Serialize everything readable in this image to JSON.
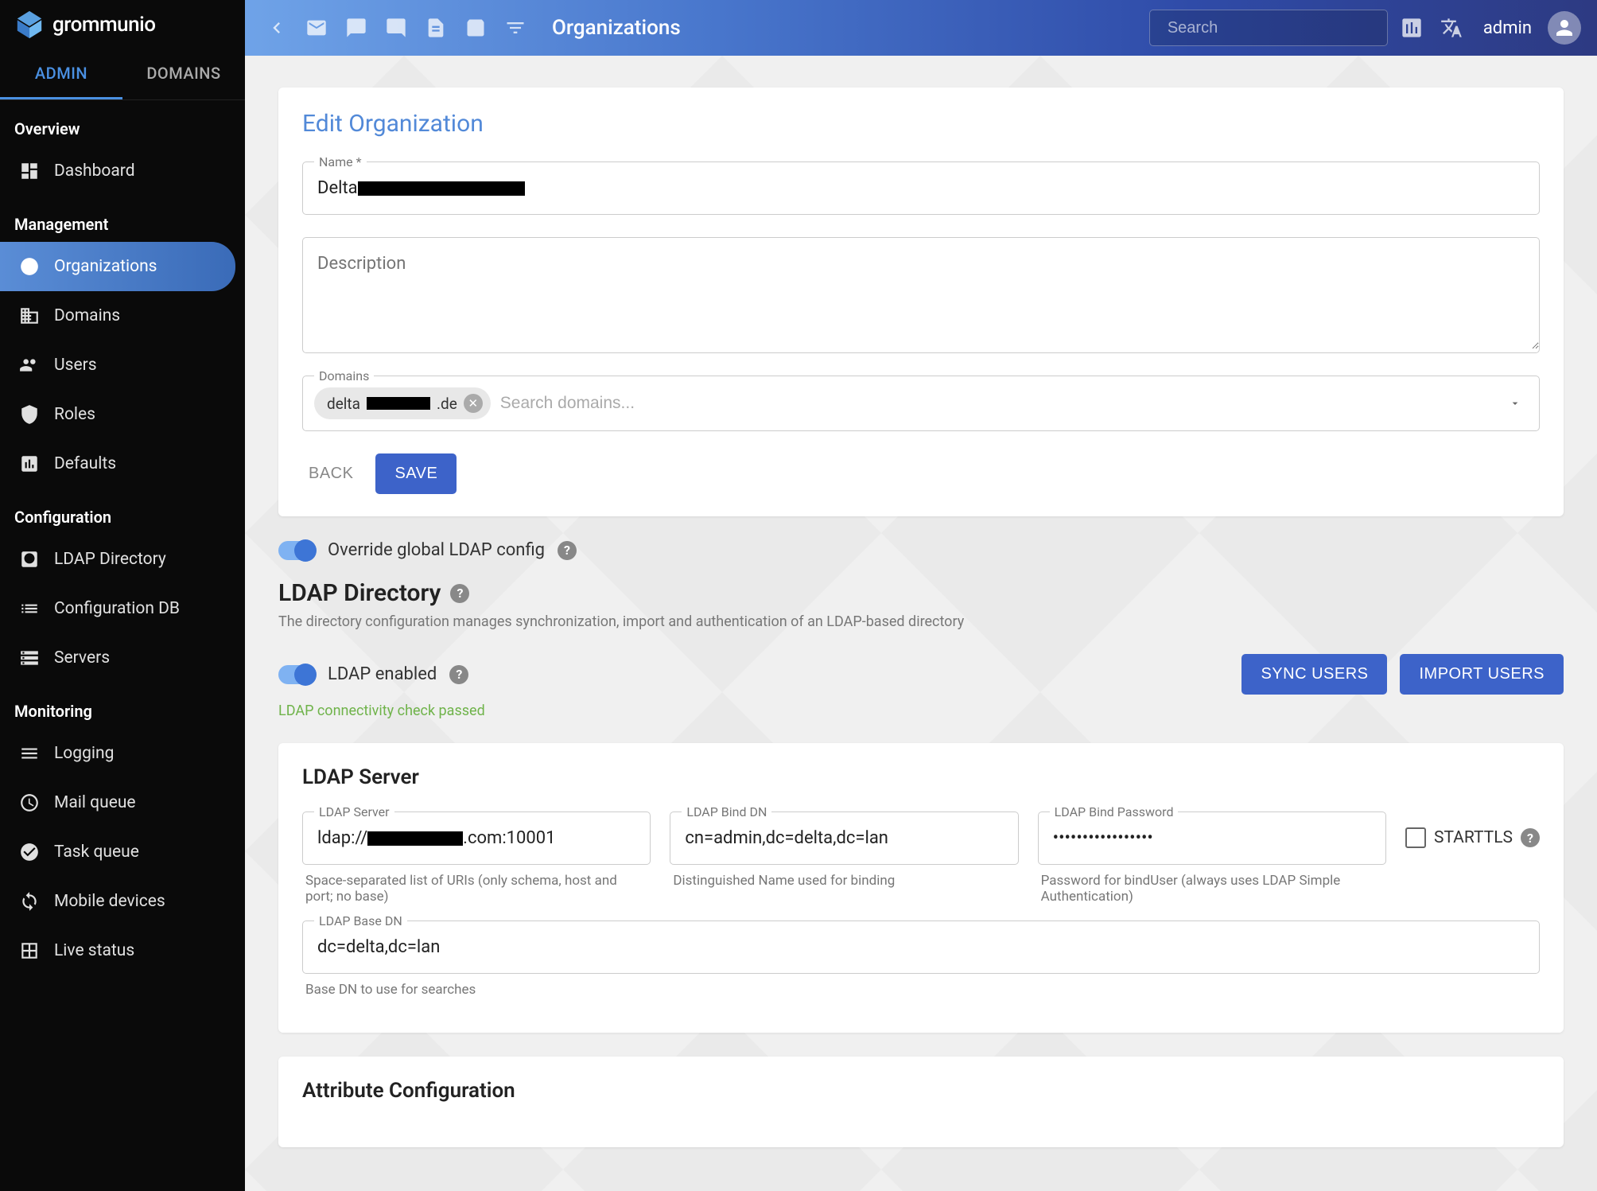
{
  "brand": "grommunio",
  "topbar": {
    "title": "Organizations",
    "search_placeholder": "Search",
    "user": "admin"
  },
  "sidebar": {
    "tabs": {
      "admin": "ADMIN",
      "domains": "DOMAINS"
    },
    "sections": {
      "overview": "Overview",
      "management": "Management",
      "configuration": "Configuration",
      "monitoring": "Monitoring"
    },
    "items": {
      "dashboard": "Dashboard",
      "organizations": "Organizations",
      "domains": "Domains",
      "users": "Users",
      "roles": "Roles",
      "defaults": "Defaults",
      "ldap_directory": "LDAP Directory",
      "configuration_db": "Configuration DB",
      "servers": "Servers",
      "logging": "Logging",
      "mail_queue": "Mail queue",
      "task_queue": "Task queue",
      "mobile_devices": "Mobile devices",
      "live_status": "Live status"
    }
  },
  "page": {
    "edit_title": "Edit Organization",
    "name_label": "Name *",
    "name_value_prefix": "Delta",
    "description_placeholder": "Description",
    "domains_label": "Domains",
    "domain_chip_prefix": "delta",
    "domain_chip_suffix": ".de",
    "domains_search_placeholder": "Search domains...",
    "back": "BACK",
    "save": "SAVE",
    "override_label": "Override global LDAP config",
    "ldap_heading": "LDAP Directory",
    "ldap_sub": "The directory configuration manages synchronization, import and authentication of an LDAP-based directory",
    "ldap_enabled": "LDAP enabled",
    "sync_users": "SYNC USERS",
    "import_users": "IMPORT USERS",
    "connectivity": "LDAP connectivity check passed",
    "ldap_server_heading": "LDAP Server",
    "fields": {
      "server_label": "LDAP Server",
      "server_prefix": "ldap://",
      "server_suffix": ".com:10001",
      "server_help": "Space-separated list of URIs (only schema, host and port; no base)",
      "binddn_label": "LDAP Bind DN",
      "binddn_value": "cn=admin,dc=delta,dc=lan",
      "binddn_help": "Distinguished Name used for binding",
      "bindpw_label": "LDAP Bind Password",
      "bindpw_value": "•••••••••••••••••",
      "bindpw_help": "Password for bindUser (always uses LDAP Simple Authentication)",
      "starttls": "STARTTLS",
      "basedn_label": "LDAP Base DN",
      "basedn_value": "dc=delta,dc=lan",
      "basedn_help": "Base DN to use for searches"
    },
    "attr_heading": "Attribute Configuration"
  }
}
